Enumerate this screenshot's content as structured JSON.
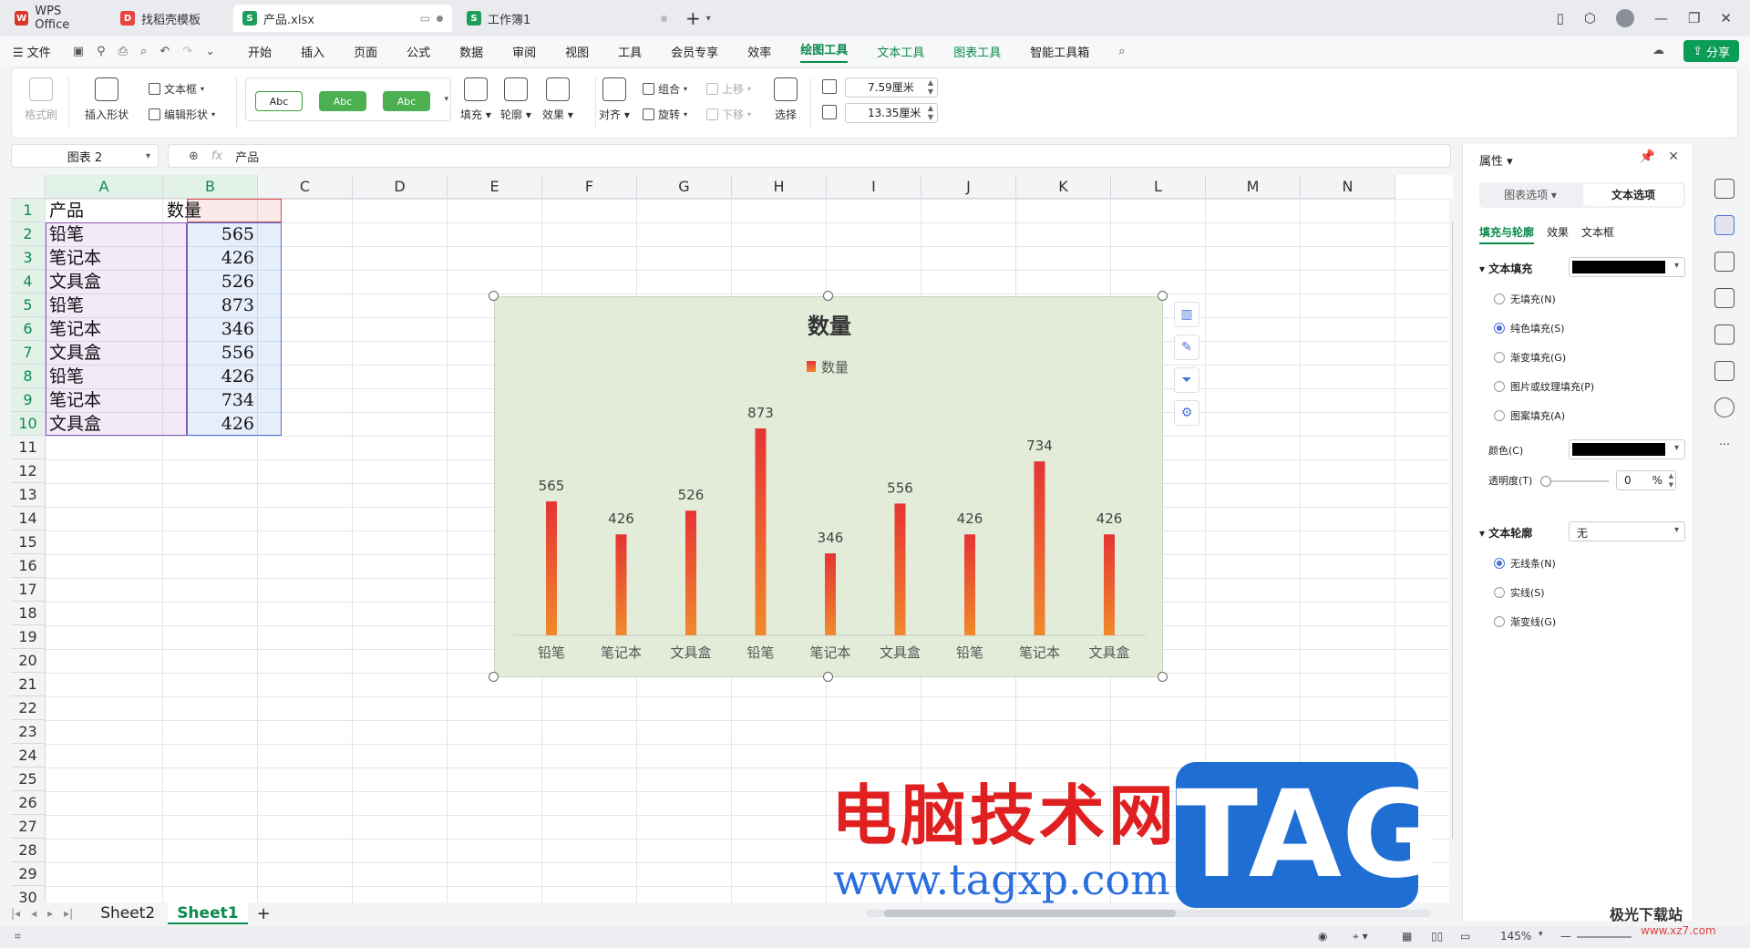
{
  "tabs": [
    {
      "label": "WPS Office",
      "icon": "wps-logo-icon",
      "color": "#d9352b",
      "active": false
    },
    {
      "label": "找稻壳模板",
      "icon": "docer-logo-icon",
      "color": "#e64640",
      "active": false
    },
    {
      "label": "产品.xlsx",
      "icon": "spreadsheet-icon",
      "color": "#1e9e5a",
      "active": true
    },
    {
      "label": "工作簿1",
      "icon": "spreadsheet-icon",
      "color": "#1e9e5a",
      "active": false
    }
  ],
  "menu": {
    "file": "文件",
    "items": [
      "开始",
      "插入",
      "页面",
      "公式",
      "数据",
      "审阅",
      "视图",
      "工具",
      "会员专享",
      "效率"
    ],
    "context_items": [
      "绘图工具",
      "文本工具",
      "图表工具"
    ],
    "smart": "智能工具箱",
    "share": "分享"
  },
  "ribbon": {
    "format_painter": "格式刷",
    "insert_shape": "插入形状",
    "text_box": "文本框",
    "edit_shape": "编辑形状",
    "styles": [
      "Abc",
      "Abc",
      "Abc"
    ],
    "fill": "填充",
    "outline": "轮廓",
    "effects": "效果",
    "align": "对齐",
    "group": "组合",
    "rotate": "旋转",
    "bring_forward": "上移",
    "send_backward": "下移",
    "select": "选择",
    "width": "7.59厘米",
    "height": "13.35厘米"
  },
  "formula_bar": {
    "name_box": "图表 2",
    "fx": "fx",
    "value": "产品"
  },
  "grid": {
    "columns": [
      "A",
      "B",
      "C",
      "D",
      "E",
      "F",
      "G",
      "H",
      "I",
      "J",
      "K",
      "L",
      "M",
      "N"
    ],
    "rows": [
      "1",
      "2",
      "3",
      "4",
      "5",
      "6",
      "7",
      "8",
      "9",
      "10",
      "11",
      "12",
      "13",
      "14",
      "15",
      "16",
      "17",
      "18",
      "19",
      "20",
      "21",
      "22",
      "23",
      "24",
      "25",
      "26",
      "27",
      "28",
      "29",
      "30"
    ],
    "header": [
      "产品",
      "数量"
    ],
    "data": [
      [
        "铅笔",
        "565"
      ],
      [
        "笔记本",
        "426"
      ],
      [
        "文具盒",
        "526"
      ],
      [
        "铅笔",
        "873"
      ],
      [
        "笔记本",
        "346"
      ],
      [
        "文具盒",
        "556"
      ],
      [
        "铅笔",
        "426"
      ],
      [
        "笔记本",
        "734"
      ],
      [
        "文具盒",
        "426"
      ]
    ]
  },
  "chart_data": {
    "type": "bar",
    "title": "数量",
    "categories": [
      "铅笔",
      "笔记本",
      "文具盒",
      "铅笔",
      "笔记本",
      "文具盒",
      "铅笔",
      "笔记本",
      "文具盒"
    ],
    "series": [
      {
        "name": "数量",
        "values": [
          565,
          426,
          526,
          873,
          346,
          556,
          426,
          734,
          426
        ]
      }
    ],
    "ylim": [
      0,
      1000
    ],
    "grid": false,
    "legend": "top",
    "data_labels": true,
    "colors": {
      "bar_top": "#e63434",
      "bar_bottom": "#f08a2c",
      "background": "#e3ecd9"
    }
  },
  "sheets": [
    "Sheet2",
    "Sheet1"
  ],
  "active_sheet": "Sheet1",
  "status": {
    "zoom": "145%"
  },
  "pane": {
    "title": "属性",
    "tabs": [
      "图表选项",
      "文本选项"
    ],
    "subtabs": [
      "填充与轮廓",
      "效果",
      "文本框"
    ],
    "text_fill": "文本填充",
    "fill_options": [
      "无填充(N)",
      "纯色填充(S)",
      "渐变填充(G)",
      "图片或纹理填充(P)",
      "图案填充(A)"
    ],
    "color_label": "颜色(C)",
    "transparency_label": "透明度(T)",
    "transparency_value": "0",
    "transparency_unit": "%",
    "text_outline": "文本轮廓",
    "outline_value": "无",
    "outline_options": [
      "无线条(N)",
      "实线(S)",
      "渐变线(G)"
    ],
    "fill_color": "#000000"
  },
  "watermark": {
    "cn": "电脑技术网",
    "url": "www.tagxp.com",
    "tag": "TAG",
    "jg": "极光下载站",
    "jg_url": "www.xz7.com"
  }
}
